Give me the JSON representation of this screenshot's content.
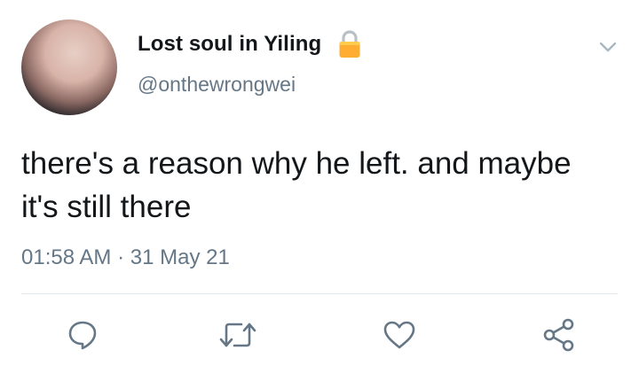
{
  "author": {
    "display_name": "Lost soul in Yiling",
    "handle": "@onthewrongwei",
    "protected_icon": "lock-icon"
  },
  "tweet": {
    "text": "there's a reason why he left. and maybe it's still there",
    "time": "01:58 AM",
    "separator": "·",
    "date": "31 May 21"
  },
  "actions": [
    "reply-icon",
    "retweet-icon",
    "like-icon",
    "share-icon"
  ],
  "colors": {
    "text": "#14171a",
    "secondary": "#657786",
    "lock": "#ffac33",
    "divider": "#e1e8ed"
  }
}
